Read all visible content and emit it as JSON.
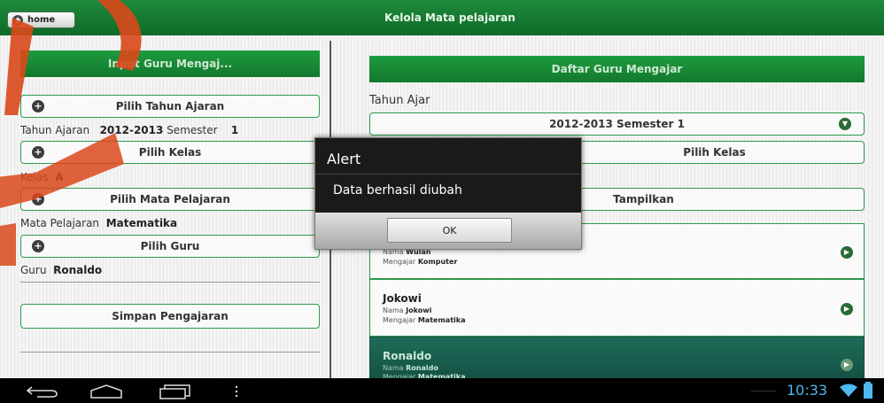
{
  "header": {
    "home_label": "home",
    "title": "Kelola Mata pelajaran"
  },
  "left": {
    "header": "Input Guru Mengaj...",
    "pilih_tahun": "Pilih Tahun Ajaran",
    "tahun_label": "Tahun Ajaran",
    "tahun_value": "2012-2013",
    "semester_label": "Semester",
    "semester_value": "1",
    "pilih_kelas": "Pilih Kelas",
    "kelas_label": "Kelas",
    "kelas_value": "A",
    "pilih_mapel": "Pilih Mata Pelajaran",
    "mapel_label": "Mata Pelajaran",
    "mapel_value": "Matematika",
    "pilih_guru": "Pilih Guru",
    "guru_label": "Guru",
    "guru_value": "Ronaldo",
    "simpan": "Simpan Pengajaran"
  },
  "right": {
    "header": "Daftar Guru Mengajar",
    "tahun_ajar_label": "Tahun Ajar",
    "tahun_select": "2012-2013 Semester 1",
    "pilih_kelas": "Pilih Kelas",
    "tampilkan": "Tampilkan",
    "cards": [
      {
        "name": "",
        "nama_label": "Nama",
        "nama_value": "Wulan",
        "mengajar_label": "Mengajar",
        "mengajar_value": "Komputer",
        "selected": false
      },
      {
        "name": "Jokowi",
        "nama_label": "Nama",
        "nama_value": "Jokowi",
        "mengajar_label": "Mengajar",
        "mengajar_value": "Matematika",
        "selected": false
      },
      {
        "name": "Ronaldo",
        "nama_label": "Nama",
        "nama_value": "Ronaldo",
        "mengajar_label": "Mengajar",
        "mengajar_value": "Matematika",
        "selected": true
      }
    ]
  },
  "dialog": {
    "title": "Alert",
    "message": "Data berhasil diubah",
    "ok_label": "OK"
  },
  "status": {
    "time": "10:33"
  },
  "colors": {
    "primary_green": "#1e9b3f",
    "dark_teal": "#145245",
    "watermark": "#d9481a"
  }
}
